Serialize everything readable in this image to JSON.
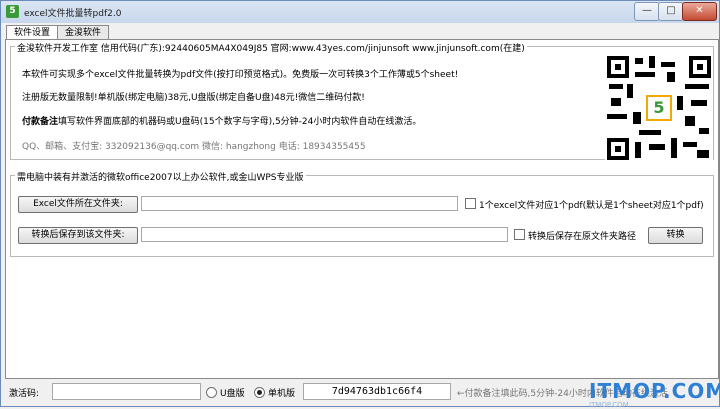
{
  "window": {
    "title": "excel文件批量转pdf2.0",
    "app_icon": "5",
    "controls": {
      "minimize": "—",
      "maximize": "□",
      "close": "✕"
    }
  },
  "tabs": [
    {
      "label": "软件设置",
      "active": true
    },
    {
      "label": "金浚软件",
      "active": false
    }
  ],
  "info": {
    "legend": "金浚软件开发工作室 信用代码(广东):92440605MA4X049J85 官网:www.43yes.com/jinjunsoft  www.jinjunsoft.com(在建)",
    "line1": "本软件可实现多个excel文件批量转换为pdf文件(按打印预览格式)。免费版一次可转换3个工作薄或5个sheet!",
    "line2": "注册版无数量限制!单机版(绑定电脑)38元,U盘版(绑定自备U盘)48元!微信二维码付款!",
    "line3_bold": "付款备注",
    "line3_rest": "填写软件界面底部的机器码或U盘码(15个数字与字母),5分钟-24小时内软件自动在线激活。",
    "contact": "QQ、邮箱、支付宝: 332092136@qq.com   微信: hangzhong   电话: 18934355455",
    "qr_logo": "5"
  },
  "convert": {
    "legend": "需电脑中装有并激活的微软office2007以上办公软件,或金山WPS专业版",
    "source_button": "Excel文件所在文件夹:",
    "source_value": "",
    "option1_label": "1个excel文件对应1个pdf(默认是1个sheet对应1个pdf)",
    "option1_checked": false,
    "target_button": "转换后保存到该文件夹:",
    "target_value": "",
    "option2_label": "转换后保存在原文件夹路径",
    "option2_checked": false,
    "convert_button": "转换"
  },
  "footer": {
    "activation_label": "激活码:",
    "activation_value": "",
    "usb_label": "U盘版",
    "usb_selected": false,
    "standalone_label": "单机版",
    "standalone_selected": true,
    "machine_code": "7d94763db1c66f4",
    "hint": "←付款备注填此码,5分钟-24小时内软件自动在线激活"
  },
  "watermark": {
    "text": "ITMOP.COM",
    "sub": "ITMOP.COM"
  }
}
